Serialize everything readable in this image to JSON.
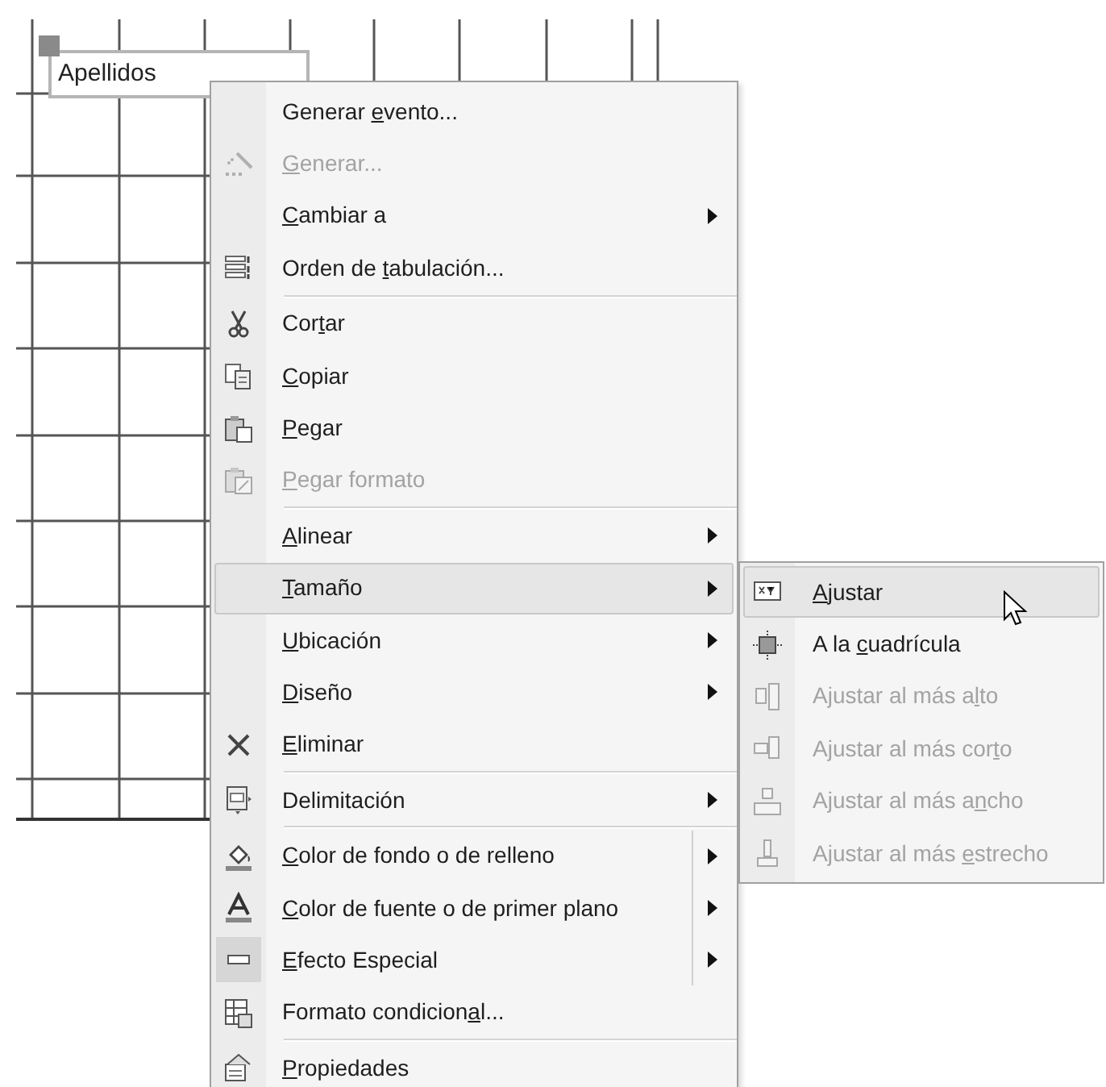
{
  "canvas": {
    "label_control": {
      "text": "Apellidos",
      "selected": true
    }
  },
  "context_menu": {
    "items": [
      {
        "kind": "item",
        "pre": "Generar ",
        "key": "e",
        "post": "vento...",
        "disabled": false,
        "selected": false,
        "checked": false,
        "submenu": false,
        "split": false
      },
      {
        "kind": "item",
        "key": "G",
        "post": "enerar...",
        "disabled": true,
        "selected": false,
        "checked": false,
        "submenu": false,
        "split": false
      },
      {
        "kind": "item",
        "key": "C",
        "post": "ambiar a",
        "disabled": false,
        "selected": false,
        "checked": false,
        "submenu": true,
        "split": false
      },
      {
        "kind": "item",
        "pre": "Orden de ",
        "key": "t",
        "post": "abulación...",
        "disabled": false,
        "selected": false,
        "checked": false,
        "submenu": false,
        "split": false
      },
      {
        "kind": "separator"
      },
      {
        "kind": "item",
        "pre": "Cor",
        "key": "t",
        "post": "ar",
        "disabled": false,
        "selected": false,
        "checked": false,
        "submenu": false,
        "split": false
      },
      {
        "kind": "item",
        "key": "C",
        "post": "opiar",
        "disabled": false,
        "selected": false,
        "checked": false,
        "submenu": false,
        "split": false
      },
      {
        "kind": "item",
        "key": "P",
        "post": "egar",
        "disabled": false,
        "selected": false,
        "checked": false,
        "submenu": false,
        "split": false
      },
      {
        "kind": "item",
        "key": "P",
        "post": "egar formato",
        "disabled": true,
        "selected": false,
        "checked": false,
        "submenu": false,
        "split": false
      },
      {
        "kind": "separator"
      },
      {
        "kind": "item",
        "key": "A",
        "post": "linear",
        "disabled": false,
        "selected": false,
        "checked": false,
        "submenu": true,
        "split": false
      },
      {
        "kind": "item",
        "key": "T",
        "post": "amaño",
        "disabled": false,
        "selected": true,
        "checked": false,
        "submenu": true,
        "split": false
      },
      {
        "kind": "item",
        "key": "U",
        "post": "bicación",
        "disabled": false,
        "selected": false,
        "checked": false,
        "submenu": true,
        "split": false
      },
      {
        "kind": "item",
        "key": "D",
        "post": "iseño",
        "disabled": false,
        "selected": false,
        "checked": false,
        "submenu": true,
        "split": false
      },
      {
        "kind": "item",
        "key": "E",
        "post": "liminar",
        "disabled": false,
        "selected": false,
        "checked": false,
        "submenu": false,
        "split": false
      },
      {
        "kind": "separator"
      },
      {
        "kind": "item",
        "pre": "Delimitación",
        "disabled": false,
        "selected": false,
        "checked": false,
        "submenu": true,
        "split": false
      },
      {
        "kind": "separator"
      },
      {
        "kind": "item",
        "key": "C",
        "post": "olor de fondo o de relleno",
        "disabled": false,
        "selected": false,
        "checked": false,
        "submenu": true,
        "split": true
      },
      {
        "kind": "item",
        "key": "C",
        "post": "olor de fuente o de primer plano",
        "disabled": false,
        "selected": false,
        "checked": false,
        "submenu": true,
        "split": true
      },
      {
        "kind": "item",
        "key": "E",
        "post": "fecto Especial",
        "disabled": false,
        "selected": false,
        "checked": true,
        "submenu": true,
        "split": true
      },
      {
        "kind": "item",
        "pre": "Formato condicion",
        "key": "a",
        "post": "l...",
        "disabled": false,
        "selected": false,
        "checked": false,
        "submenu": false,
        "split": false
      },
      {
        "kind": "separator"
      },
      {
        "kind": "item",
        "key": "P",
        "post": "ropiedades",
        "disabled": false,
        "selected": false,
        "checked": false,
        "submenu": false,
        "split": false
      }
    ]
  },
  "submenu": {
    "items": [
      {
        "key": "A",
        "post": "justar",
        "disabled": false,
        "selected": true
      },
      {
        "pre": "A la ",
        "key": "c",
        "post": "uadrícula",
        "disabled": false,
        "selected": false
      },
      {
        "pre": "Ajustar al más a",
        "key": "l",
        "post": "to",
        "disabled": true,
        "selected": false
      },
      {
        "pre": "Ajustar al más cor",
        "key": "t",
        "post": "o",
        "disabled": true,
        "selected": false
      },
      {
        "pre": "Ajustar al más a",
        "key": "n",
        "post": "cho",
        "disabled": true,
        "selected": false
      },
      {
        "pre": "Ajustar al más ",
        "key": "e",
        "post": "strecho",
        "disabled": true,
        "selected": false
      }
    ]
  }
}
